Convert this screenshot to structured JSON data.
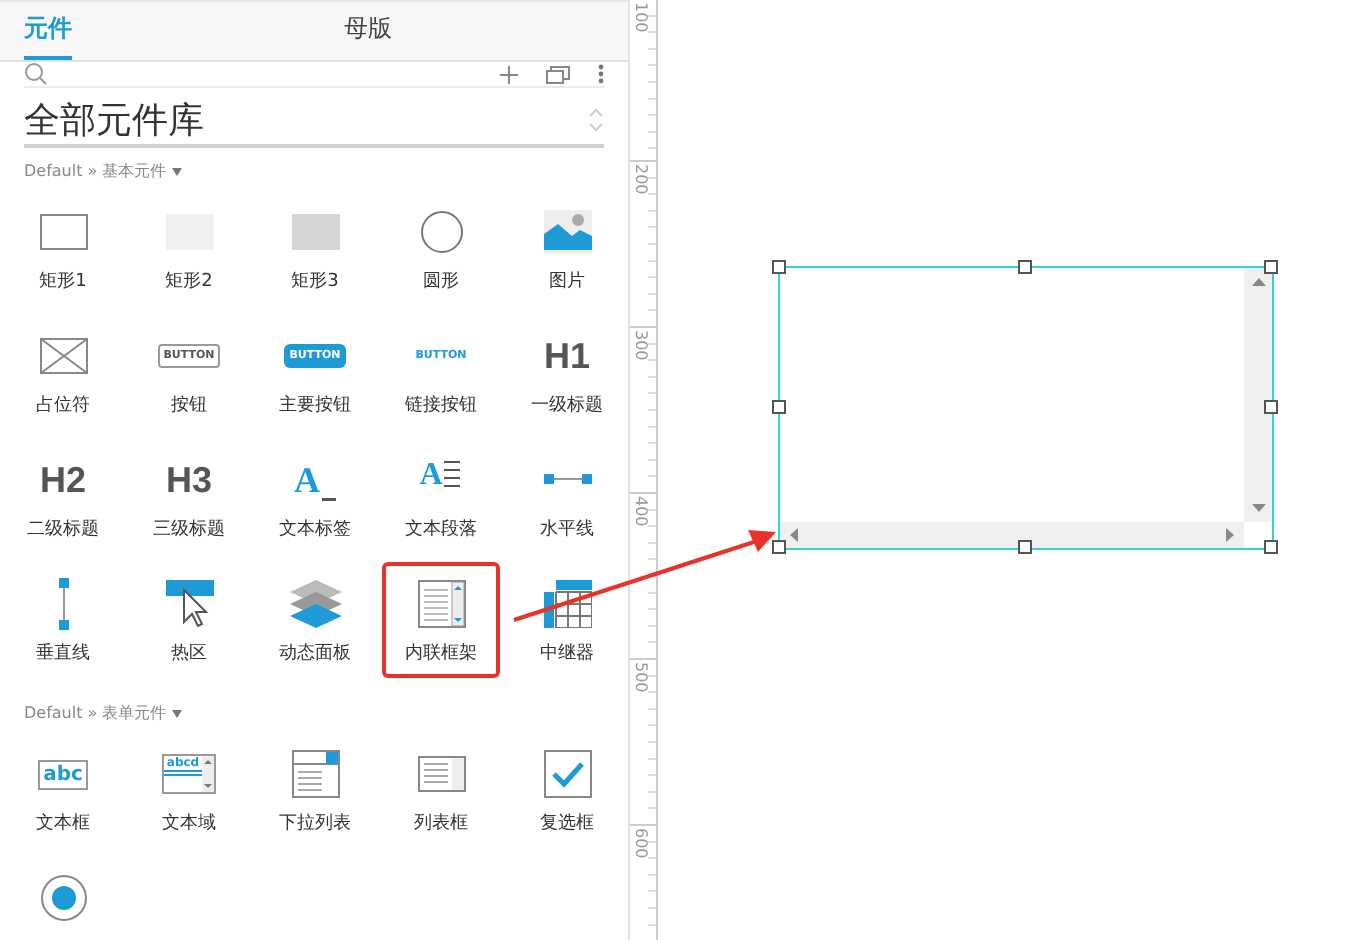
{
  "tabs": [
    {
      "label": "元件",
      "selected": true
    },
    {
      "label": "母版",
      "selected": false
    }
  ],
  "library": {
    "title": "全部元件库"
  },
  "sections": [
    {
      "title": "Default » 基本元件",
      "items": [
        {
          "kind": "rect1",
          "label": "矩形1",
          "selected": false
        },
        {
          "kind": "rect2",
          "label": "矩形2",
          "selected": false
        },
        {
          "kind": "rect3",
          "label": "矩形3",
          "selected": false
        },
        {
          "kind": "circle",
          "label": "圆形",
          "selected": false
        },
        {
          "kind": "image",
          "label": "图片",
          "selected": false
        },
        {
          "kind": "placeholder",
          "label": "占位符",
          "selected": false
        },
        {
          "kind": "button",
          "label": "按钮",
          "icon_text": "BUTTON",
          "selected": false
        },
        {
          "kind": "primary",
          "label": "主要按钮",
          "icon_text": "BUTTON",
          "selected": false
        },
        {
          "kind": "link",
          "label": "链接按钮",
          "icon_text": "BUTTON",
          "selected": false
        },
        {
          "kind": "heading",
          "label": "一级标题",
          "icon_text": "H1",
          "selected": false
        },
        {
          "kind": "heading",
          "label": "二级标题",
          "icon_text": "H2",
          "selected": false
        },
        {
          "kind": "heading",
          "label": "三级标题",
          "icon_text": "H3",
          "selected": false
        },
        {
          "kind": "textlabel",
          "label": "文本标签",
          "icon_text": "A",
          "selected": false
        },
        {
          "kind": "paragraph",
          "label": "文本段落",
          "icon_text": "A",
          "selected": false
        },
        {
          "kind": "hline",
          "label": "水平线",
          "selected": false
        },
        {
          "kind": "vline",
          "label": "垂直线",
          "selected": false
        },
        {
          "kind": "hotspot",
          "label": "热区",
          "selected": false
        },
        {
          "kind": "panel",
          "label": "动态面板",
          "selected": false
        },
        {
          "kind": "iframe",
          "label": "内联框架",
          "selected": true
        },
        {
          "kind": "repeater",
          "label": "中继器",
          "selected": false
        }
      ]
    },
    {
      "title": "Default » 表单元件",
      "items": [
        {
          "kind": "textbox",
          "label": "文本框",
          "icon_text": "abc",
          "selected": false
        },
        {
          "kind": "textarea",
          "label": "文本域",
          "icon_text": "abcd",
          "selected": false
        },
        {
          "kind": "dropdown",
          "label": "下拉列表",
          "selected": false
        },
        {
          "kind": "listbox",
          "label": "列表框",
          "selected": false
        },
        {
          "kind": "checkbox",
          "label": "复选框",
          "selected": false
        },
        {
          "kind": "radio",
          "selected": false
        }
      ]
    }
  ],
  "ruler": {
    "labels": [
      "100",
      "200",
      "300",
      "400",
      "500",
      "600"
    ]
  }
}
